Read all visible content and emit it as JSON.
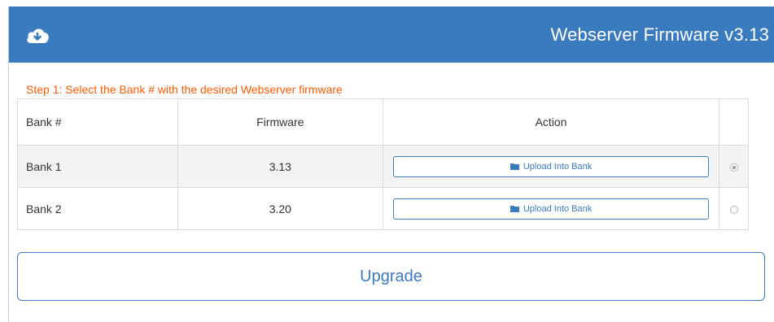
{
  "header": {
    "icon": "cloud-download-icon",
    "title": "Webserver Firmware v3.13",
    "bg_color": "#3a7bc0"
  },
  "step1": {
    "text": "Step 1: Select the Bank # with the desired Webserver firmware",
    "color": "#ff5a00"
  },
  "table": {
    "headers": [
      "Bank #",
      "Firmware",
      "Action"
    ],
    "rows": [
      {
        "bank": "Bank 1",
        "firmware": "3.13",
        "action_label": "Upload Into Bank",
        "selected": true
      },
      {
        "bank": "Bank 2",
        "firmware": "3.20",
        "action_label": "Upload Into Bank",
        "selected": false
      }
    ]
  },
  "upgrade_label": "Upgrade"
}
